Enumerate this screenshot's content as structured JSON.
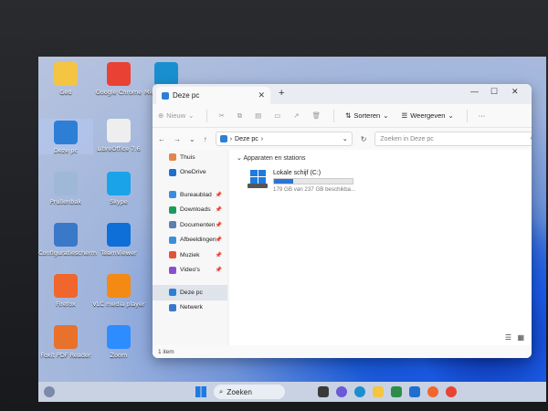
{
  "desktop": {
    "icons": [
      {
        "label": "Ged",
        "name": "desktop-icon-ged",
        "icon": "folder-user-icon",
        "color": "#f4c542"
      },
      {
        "label": "Google Chrome",
        "name": "desktop-icon-chrome",
        "icon": "chrome-icon",
        "color": "#e94235"
      },
      {
        "label": "Microsoft Edge",
        "name": "desktop-icon-edge",
        "icon": "edge-icon",
        "color": "#1a8fd0"
      },
      {
        "label": "Deze pc",
        "name": "desktop-icon-deze-pc",
        "icon": "computer-icon",
        "color": "#2d7fd6"
      },
      {
        "label": "LibreOffice 7.6",
        "name": "desktop-icon-libreoffice",
        "icon": "document-icon",
        "color": "#eeeeee"
      },
      {
        "label": "Prullenbak",
        "name": "desktop-icon-prullenbak",
        "icon": "recycle-bin-icon",
        "color": "#9fb8d8"
      },
      {
        "label": "Skype",
        "name": "desktop-icon-skype",
        "icon": "skype-icon",
        "color": "#1aa3e8"
      },
      {
        "label": "Configuratiescherm",
        "name": "desktop-icon-configuratiescherm",
        "icon": "control-panel-icon",
        "color": "#3a78c8"
      },
      {
        "label": "TeamViewer",
        "name": "desktop-icon-teamviewer",
        "icon": "teamviewer-icon",
        "color": "#0e6fd8"
      },
      {
        "label": "Firefox",
        "name": "desktop-icon-firefox",
        "icon": "firefox-icon",
        "color": "#f0662d"
      },
      {
        "label": "VLC media player",
        "name": "desktop-icon-vlc",
        "icon": "vlc-cone-icon",
        "color": "#f28a14"
      },
      {
        "label": "Foxit PDF Reader",
        "name": "desktop-icon-foxit",
        "icon": "pdf-icon",
        "color": "#e8712c"
      },
      {
        "label": "Zoom",
        "name": "desktop-icon-zoom",
        "icon": "zoom-icon",
        "color": "#2d8cff"
      }
    ]
  },
  "explorer": {
    "tab_title": "Deze pc",
    "tab_close": "✕",
    "new_tab": "+",
    "window_controls": {
      "minimize": "—",
      "maximize": "☐",
      "close": "✕"
    },
    "command_bar": {
      "new_label": "Nieuw",
      "sort_label": "Sorteren",
      "view_label": "Weergeven",
      "more_label": "···"
    },
    "address": {
      "path": "Deze pc",
      "search_placeholder": "Zoeken in Deze pc"
    },
    "nav": [
      {
        "label": "Thuis",
        "name": "nav-thuis",
        "icon": "home-icon",
        "color": "#e0864a",
        "pinned": false
      },
      {
        "label": "OneDrive",
        "name": "nav-onedrive",
        "icon": "cloud-icon",
        "color": "#1f6fd0",
        "pinned": false
      },
      {
        "label": "Bureaublad",
        "name": "nav-bureaublad",
        "icon": "desktop-folder-icon",
        "color": "#3d8be0",
        "pinned": true
      },
      {
        "label": "Downloads",
        "name": "nav-downloads",
        "icon": "download-icon",
        "color": "#1a9b5a",
        "pinned": true
      },
      {
        "label": "Documenten",
        "name": "nav-documenten",
        "icon": "documents-icon",
        "color": "#5a7fb0",
        "pinned": true
      },
      {
        "label": "Afbeeldingen",
        "name": "nav-afbeeldingen",
        "icon": "pictures-icon",
        "color": "#3a8fd8",
        "pinned": true
      },
      {
        "label": "Muziek",
        "name": "nav-muziek",
        "icon": "music-icon",
        "color": "#e0533a",
        "pinned": true
      },
      {
        "label": "Video's",
        "name": "nav-videos",
        "icon": "video-icon",
        "color": "#8a4fd0",
        "pinned": true
      },
      {
        "label": "Deze pc",
        "name": "nav-deze-pc",
        "icon": "computer-icon",
        "color": "#2d7fd6",
        "pinned": false,
        "selected": true
      },
      {
        "label": "Netwerk",
        "name": "nav-netwerk",
        "icon": "network-icon",
        "color": "#3a78c8",
        "pinned": false
      }
    ],
    "group_header": "Apparaten en stations",
    "drive": {
      "name": "Lokale schijf (C:)",
      "free_text": "179 GB van 237 GB beschikba...",
      "used_fraction": 0.245,
      "fill_color": "#2a74d8"
    },
    "status": "1 item"
  },
  "taskbar": {
    "search_label": "Zoeken"
  }
}
